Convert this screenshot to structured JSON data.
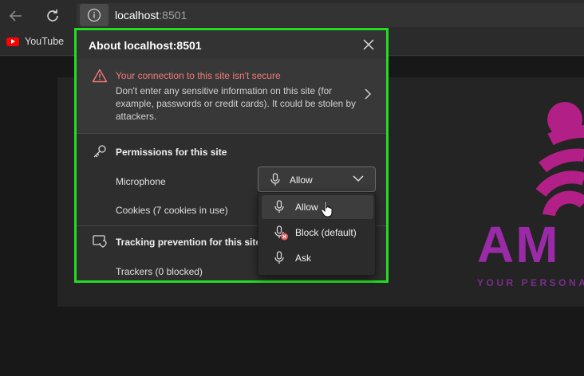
{
  "address_bar": {
    "host": "localhost",
    "port": ":8501"
  },
  "bookmarks": [
    {
      "label": "YouTube"
    }
  ],
  "page": {
    "brand_partial": "AM",
    "tagline_partial": "YOUR PERSONA"
  },
  "popup": {
    "title": "About localhost:8501",
    "security": {
      "title": "Your connection to this site isn't secure",
      "description": "Don't enter any sensitive information on this site (for example, passwords or credit cards). It could be stolen by attackers."
    },
    "permissions": {
      "title": "Permissions for this site",
      "microphone_label": "Microphone",
      "microphone_value": "Allow",
      "cookies_label": "Cookies (7 cookies in use)"
    },
    "tracking": {
      "title": "Tracking prevention for this site",
      "trackers_label": "Trackers (0 blocked)"
    }
  },
  "dropdown": {
    "options": [
      {
        "label": "Allow",
        "hovered": true
      },
      {
        "label": "Block (default)"
      },
      {
        "label": "Ask"
      }
    ]
  },
  "colors": {
    "highlight_border": "#22dd22",
    "warning": "#f07a7a",
    "brand": "#9b2aa8",
    "youtube": "#ff0000"
  }
}
